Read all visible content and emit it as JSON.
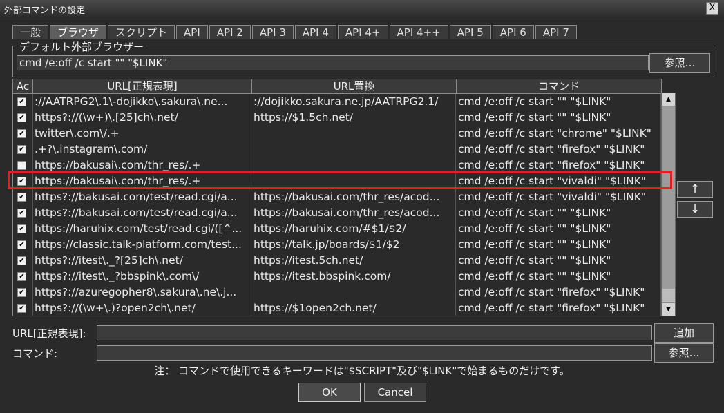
{
  "window": {
    "title": "外部コマンドの設定",
    "close": "X"
  },
  "tabs": [
    "一般",
    "ブラウザ",
    "スクリプト",
    "API",
    "API 2",
    "API 3",
    "API 4",
    "API 4+",
    "API 4++",
    "API 5",
    "API 6",
    "API 7"
  ],
  "active_tab": "ブラウザ",
  "default_browser": {
    "label": "デフォルト外部ブラウザー",
    "value": "cmd /e:off /c start \"\" \"$LINK\"",
    "browse": "参照…"
  },
  "table": {
    "headers": [
      "Ac",
      "URL[正規表現]",
      "URL置換",
      "コマンド"
    ],
    "rows": [
      {
        "checked": true,
        "url": "://AATRPG2\\.1\\-dojikko\\.sakura\\.ne...",
        "replace": "://dojikko.sakura.ne.jp/AATRPG2.1/",
        "cmd": "cmd /e:off /c start \"\" \"$LINK\""
      },
      {
        "checked": true,
        "url": "https?://(\\w+)\\.[25]ch\\.net/",
        "replace": "https://$1.5ch.net/",
        "cmd": "cmd /e:off /c start \"\" \"$LINK\""
      },
      {
        "checked": true,
        "url": "twitter\\.com\\/.+",
        "replace": "",
        "cmd": "cmd /e:off /c start \"chrome\" \"$LINK\""
      },
      {
        "checked": true,
        "url": ".+?\\.instagram\\.com/",
        "replace": "",
        "cmd": "cmd /e:off /c start \"firefox\" \"$LINK\""
      },
      {
        "checked": false,
        "url": "https://bakusai\\.com/thr_res/.+",
        "replace": "",
        "cmd": "cmd /e:off /c start \"firefox\" \"$LINK\""
      },
      {
        "checked": true,
        "url": "https://bakusai\\.com/thr_res/.+",
        "replace": "",
        "cmd": "cmd /e:off /c start \"vivaldi\" \"$LINK\""
      },
      {
        "checked": true,
        "url": "https?://bakusai.com/test/read.cgi/a...",
        "replace": "https://bakusai.com/thr_res/acod...",
        "cmd": "cmd /e:off /c start \"vivaldi\" \"$LINK\""
      },
      {
        "checked": true,
        "url": "https?://bakusai.com/test/read.cgi/a...",
        "replace": "https://bakusai.com/thr_res/acod...",
        "cmd": "cmd /e:off /c start \"\" \"$LINK\""
      },
      {
        "checked": true,
        "url": "https://haruhix.com/test/read.cgi/([^...",
        "replace": "https://haruhix.com/#$1/$2/",
        "cmd": "cmd /e:off /c start \"\" \"$LINK\""
      },
      {
        "checked": true,
        "url": "https://classic.talk-platform.com/test...",
        "replace": "https://talk.jp/boards/$1/$2",
        "cmd": "cmd /e:off /c start \"\" \"$LINK\""
      },
      {
        "checked": true,
        "url": "https?://itest\\._?[25]ch\\.net/",
        "replace": "https://itest.5ch.net/",
        "cmd": "cmd /e:off /c start \"\" \"$LINK\""
      },
      {
        "checked": true,
        "url": "https?://itest\\._?bbspink\\.com\\/",
        "replace": "https://itest.bbspink.com/",
        "cmd": "cmd /e:off /c start \"\" \"$LINK\""
      },
      {
        "checked": true,
        "url": "https?://azuregopher8\\.sakura\\.ne\\.j...",
        "replace": "",
        "cmd": "cmd /e:off /c start \"firefox\" \"$LINK\""
      },
      {
        "checked": true,
        "url": "https?://(\\w+\\.)?open2ch\\.net/",
        "replace": "https://$1open2ch.net/",
        "cmd": "cmd /e:off /c start \"firefox\" \"$LINK\""
      }
    ]
  },
  "move_up": "↑",
  "move_down": "↓",
  "form": {
    "url_label": "URL[正規表現]:",
    "cmd_label": "コマンド:",
    "add": "追加",
    "browse": "参照…"
  },
  "note": "注： コマンドで使用できるキーワードは\"$SCRIPT\"及び\"$LINK\"で始まるものだけです。",
  "ok": "OK",
  "cancel": "Cancel",
  "check_mark": "✔",
  "icons": {
    "scroll_up": "▲",
    "scroll_down": "▼"
  }
}
